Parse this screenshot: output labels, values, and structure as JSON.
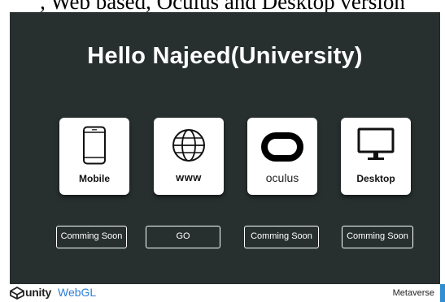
{
  "caption": ", Web based, Oculus and Desktop version",
  "canvas": {
    "title": "Hello Najeed(University)",
    "background": "#28302f"
  },
  "cards": [
    {
      "label": "Mobile",
      "icon": "smartphone-icon",
      "button": "Comming Soon"
    },
    {
      "label": "www",
      "icon": "globe-icon",
      "button": "GO"
    },
    {
      "label": "oculus",
      "icon": "oculus-headset-icon",
      "button": "Comming Soon"
    },
    {
      "label": "Desktop",
      "icon": "desktop-monitor-icon",
      "button": "Comming Soon"
    }
  ],
  "footer": {
    "brand": "unity",
    "product": "WebGL",
    "app_name": "Metaverse",
    "accent": "#2f7fd5"
  }
}
